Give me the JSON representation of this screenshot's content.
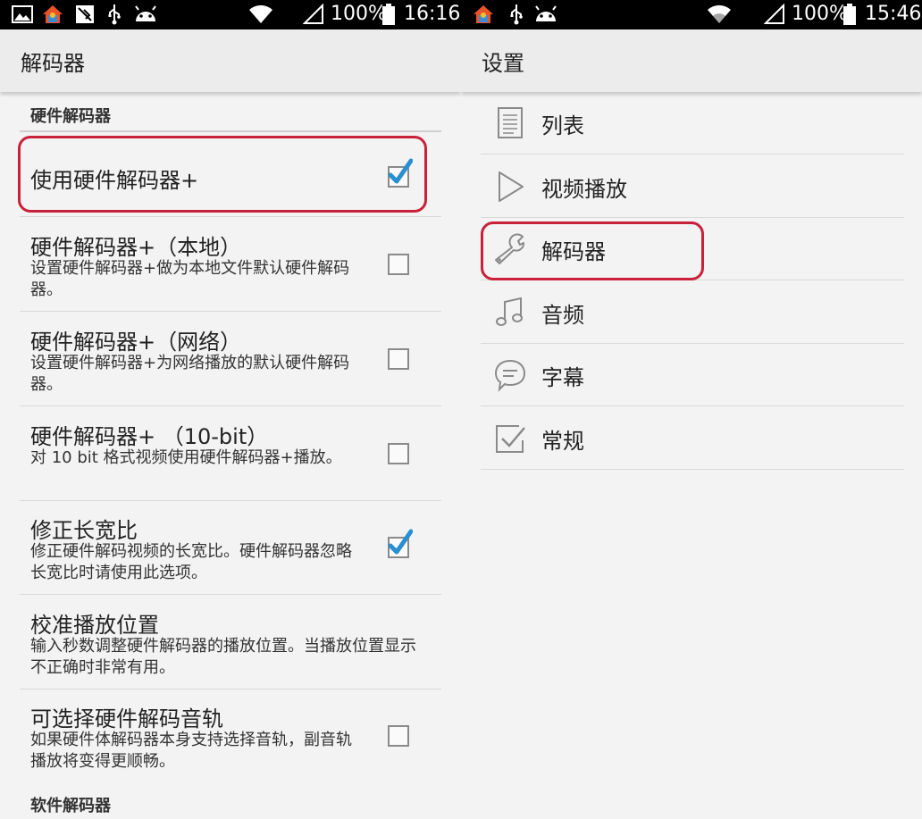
{
  "left": {
    "status_bar": {
      "battery": "100%",
      "time": "16:16"
    },
    "title": "解码器",
    "sections": {
      "hardware": "硬件解码器",
      "software": "软件解码器"
    },
    "prefs": [
      {
        "title": "使用硬件解码器+",
        "summary": "",
        "checked": true
      },
      {
        "title": "硬件解码器+（本地）",
        "summary": "设置硬件解码器+做为本地文件默认硬件解码器。",
        "checked": false
      },
      {
        "title": "硬件解码器+（网络）",
        "summary": "设置硬件解码器+为网络播放的默认硬件解码器。",
        "checked": false
      },
      {
        "title": "硬件解码器+ （10-bit）",
        "summary": "对 10 bit 格式视频使用硬件解码器+播放。",
        "checked": false
      },
      {
        "title": "修正长宽比",
        "summary": "修正硬件解码视频的长宽比。硬件解码器忽略长宽比时请使用此选项。",
        "checked": true
      },
      {
        "title": "校准播放位置",
        "summary": "输入秒数调整硬件解码器的播放位置。当播放位置显示不正确时非常有用。"
      },
      {
        "title": "可选择硬件解码音轨",
        "summary": "如果硬件体解码器本身支持选择音轨，副音轨播放将变得更顺畅。",
        "checked": false
      }
    ]
  },
  "right": {
    "status_bar": {
      "battery": "100%",
      "time": "15:46"
    },
    "title": "设置",
    "items": [
      {
        "label": "列表",
        "icon": "list-icon"
      },
      {
        "label": "视频播放",
        "icon": "play-icon"
      },
      {
        "label": "解码器",
        "icon": "wrench-icon"
      },
      {
        "label": "音频",
        "icon": "music-note-icon"
      },
      {
        "label": "字幕",
        "icon": "speech-bubble-icon"
      },
      {
        "label": "常规",
        "icon": "check-box-icon"
      }
    ]
  },
  "colors": {
    "highlight": "#c8223a",
    "checkbox_check": "#2a8fd0"
  }
}
